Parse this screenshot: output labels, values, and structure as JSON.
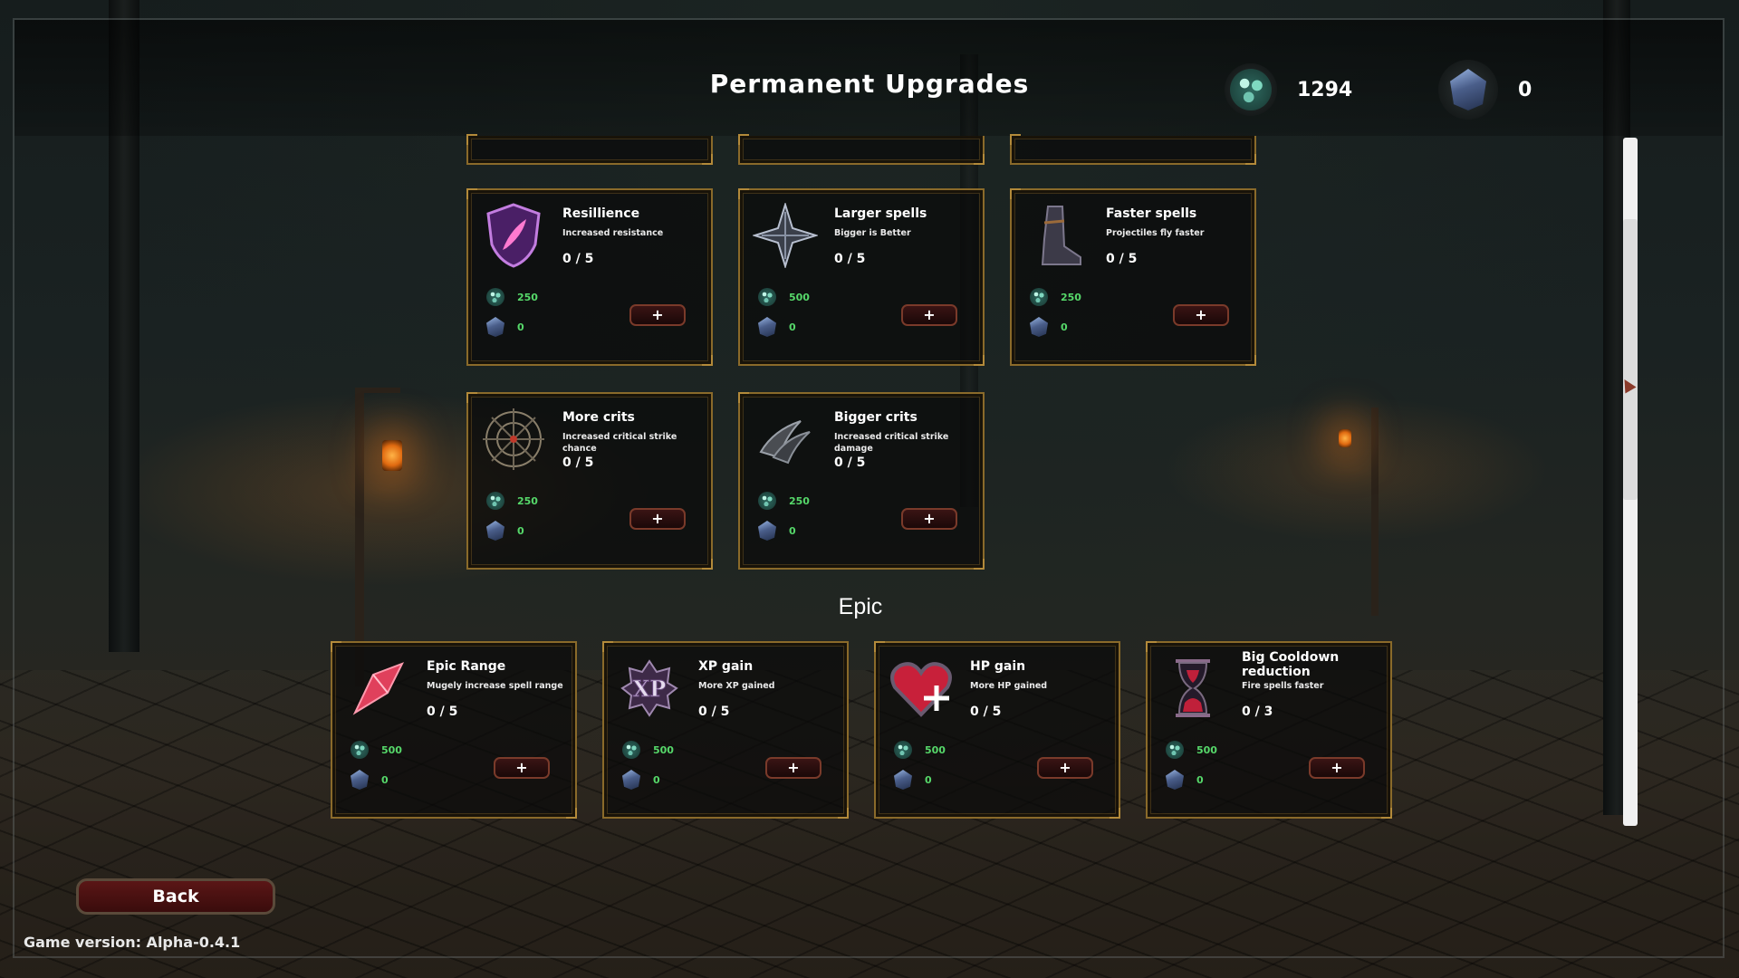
{
  "header": {
    "title": "Permanent Upgrades",
    "currency_gems": "1294",
    "currency_shards": "0"
  },
  "rows": [
    [
      {
        "name": "Resillience",
        "desc": "Increased resistance",
        "level": "0 / 5",
        "cost_gems": "250",
        "cost_shards": "0",
        "icon": "purple-shield-feather-icon"
      },
      {
        "name": "Larger spells",
        "desc": "Bigger is Better",
        "level": "0 / 5",
        "cost_gems": "500",
        "cost_shards": "0",
        "icon": "four-point-star-icon"
      },
      {
        "name": "Faster spells",
        "desc": "Projectiles fly faster",
        "level": "0 / 5",
        "cost_gems": "250",
        "cost_shards": "0",
        "icon": "boot-icon"
      }
    ],
    [
      {
        "name": "More crits",
        "desc": "Increased critical strike chance",
        "level": "0 / 5",
        "cost_gems": "250",
        "cost_shards": "0",
        "icon": "crosshair-icon"
      },
      {
        "name": "Bigger crits",
        "desc": "Increased critical strike damage",
        "level": "0 / 5",
        "cost_gems": "250",
        "cost_shards": "0",
        "icon": "claw-icon"
      }
    ]
  ],
  "epic": {
    "label": "Epic",
    "cards": [
      {
        "name": "Epic Range",
        "desc": "Mugely increase spell range",
        "level": "0 / 5",
        "cost_gems": "500",
        "cost_shards": "0",
        "icon": "red-crystal-icon"
      },
      {
        "name": "XP gain",
        "desc": "More XP gained",
        "level": "0 / 5",
        "cost_gems": "500",
        "cost_shards": "0",
        "icon": "xp-badge-icon",
        "icon_text": "XP"
      },
      {
        "name": "HP gain",
        "desc": "More HP gained",
        "level": "0 / 5",
        "cost_gems": "500",
        "cost_shards": "0",
        "icon": "heart-icon"
      },
      {
        "name": "Big Cooldown reduction",
        "desc": "Fire spells faster",
        "level": "0 / 3",
        "cost_gems": "500",
        "cost_shards": "0",
        "icon": "hourglass-icon"
      }
    ]
  },
  "plus_label": "+",
  "footer": {
    "back_label": "Back",
    "version": "Game version: Alpha-0.4.1"
  }
}
